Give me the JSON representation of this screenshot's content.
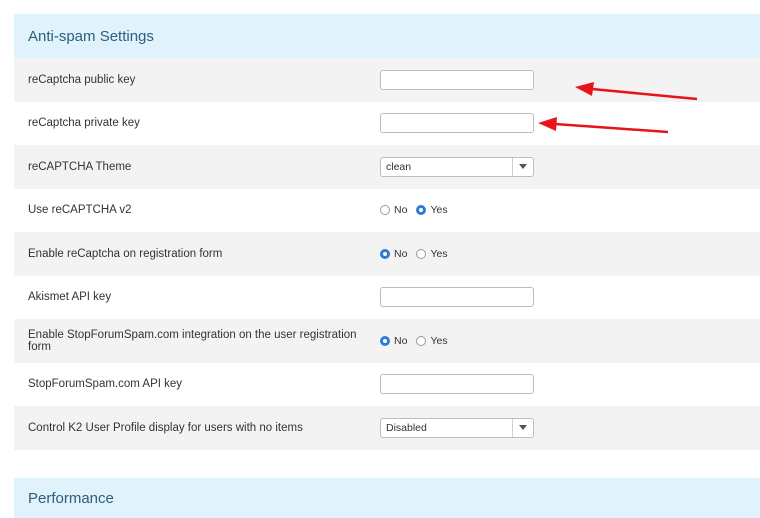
{
  "sections": {
    "anti_spam": {
      "title": "Anti-spam Settings"
    },
    "performance": {
      "title": "Performance"
    }
  },
  "settings": [
    {
      "label": "reCaptcha public key",
      "control": "text",
      "value": ""
    },
    {
      "label": "reCaptcha private key",
      "control": "text",
      "value": ""
    },
    {
      "label": "reCAPTCHA Theme",
      "control": "select",
      "value": "clean"
    },
    {
      "label": "Use reCAPTCHA v2",
      "control": "radio",
      "options": [
        "No",
        "Yes"
      ],
      "selected": "Yes"
    },
    {
      "label": "Enable reCaptcha on registration form",
      "control": "radio",
      "options": [
        "No",
        "Yes"
      ],
      "selected": "No"
    },
    {
      "label": "Akismet API key",
      "control": "text",
      "value": ""
    },
    {
      "label": "Enable StopForumSpam.com integration on the user registration form",
      "control": "radio",
      "options": [
        "No",
        "Yes"
      ],
      "selected": "No"
    },
    {
      "label": "StopForumSpam.com API key",
      "control": "text",
      "value": ""
    },
    {
      "label": "Control K2 User Profile display for users with no items",
      "control": "select",
      "value": "Disabled"
    }
  ],
  "colors": {
    "header_bg": "#e0f2fb",
    "header_text": "#2b5f7e",
    "radio_selected": "#2d7bd6",
    "annotation_arrow": "#e8141a"
  },
  "icons": {
    "select_caret": "caret-down-icon",
    "annotation": "red-arrow-icon"
  }
}
